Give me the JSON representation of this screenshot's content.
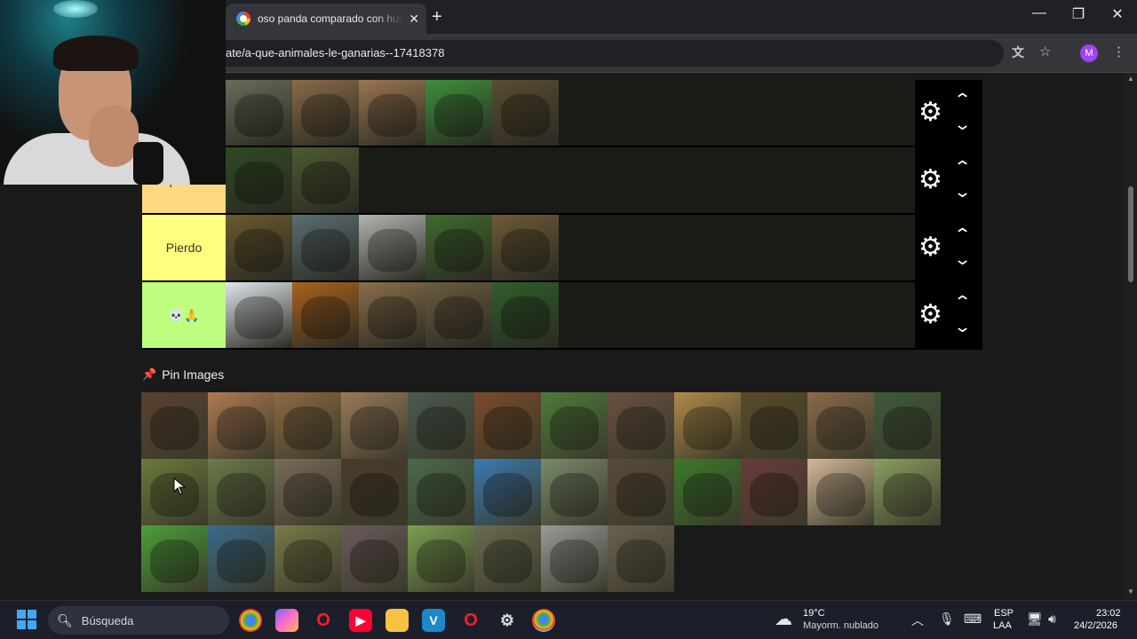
{
  "browser": {
    "tab_title": "oso panda comparado con hum",
    "tab_close": "✕",
    "new_tab": "+",
    "url": "ate/a-que-animales-le-ganarias--17418378",
    "profile_initial": "M",
    "window": {
      "minimize": "—",
      "maximize": "❐",
      "close": "✕"
    }
  },
  "tiers": [
    {
      "label": "",
      "color": "#1a1a17",
      "tiles": [
        "#6b6b5a",
        "#8a6a48",
        "#9a7550",
        "#3e8f3a",
        "#5a4d30"
      ]
    },
    {
      "label": "Empatamos",
      "color": "#ffd97f",
      "tiles": [
        "#2e4a22",
        "#4d5a30"
      ]
    },
    {
      "label": "Pierdo",
      "color": "#ffff7f",
      "tiles": [
        "#6a5a2e",
        "#5b6e72",
        "#b4b4b0",
        "#3f6b2e",
        "#6d5a35"
      ]
    },
    {
      "label": "💀🙏",
      "color": "#bfff7f",
      "tiles": [
        "#dfe6ea",
        "#a8621e",
        "#8a6e4a",
        "#6b5a40",
        "#2f5e2a"
      ]
    }
  ],
  "pin_section": {
    "title": "Pin Images",
    "icon": "pin-icon",
    "tiles": [
      "#5a4030",
      "#b07a52",
      "#8d6a42",
      "#9a7a5a",
      "#4a5a50",
      "#7a4a2a",
      "#4e7a3a",
      "#6a5040",
      "#b08a4a",
      "#5a4a2a",
      "#8a6a4a",
      "#3e5a3a",
      "#6a7a3a",
      "#6a7a4a",
      "#7a6a5a",
      "#4a3a2a",
      "#4a6a4a",
      "#3a7ab4",
      "#7a8a6a",
      "#5a4a3a",
      "#3a7a2a",
      "#6a3a3a",
      "#d4b898",
      "#8aa060",
      "#4aa03a",
      "#3a6a8a",
      "#7a7a4a",
      "#6a5a5a",
      "#7aa050",
      "#6a6a50",
      "#9a9a9a",
      "#6a6050"
    ]
  },
  "taskbar": {
    "search_text": "Búsqueda",
    "weather_temp": "19°C",
    "weather_desc": "Mayorm. nublado",
    "lang_line1": "ESP",
    "lang_line2": "LAA",
    "time": "23:02",
    "date": "24/2/2026"
  },
  "colors": {
    "accent_profile": "#a142f4",
    "tier_controls_bg": "#000000",
    "pin_icon": "#e0245e"
  }
}
